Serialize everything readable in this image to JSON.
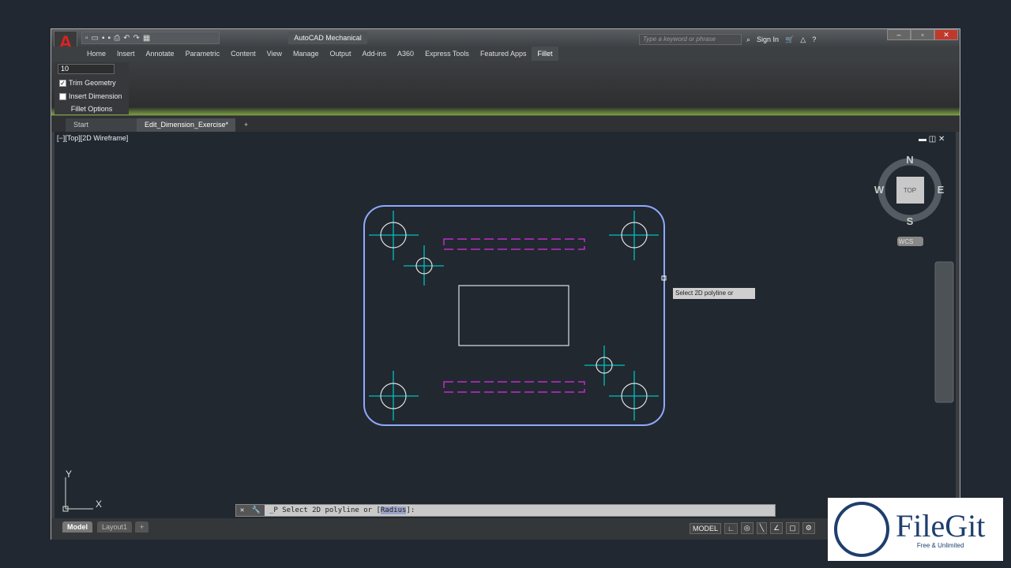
{
  "app": {
    "logo_letter": "A",
    "title": "AutoCAD Mechanical",
    "search_placeholder": "Type a keyword or phrase",
    "sign_in": "Sign In",
    "window_controls": [
      "–",
      "▫",
      "✕"
    ]
  },
  "ribbon": {
    "tabs": [
      "Home",
      "Insert",
      "Annotate",
      "Parametric",
      "Content",
      "View",
      "Manage",
      "Output",
      "Add-ins",
      "A360",
      "Express Tools",
      "Featured Apps",
      "Fillet"
    ],
    "active_tab": "Fillet",
    "fillet": {
      "radius_value": "10",
      "trim_geometry": {
        "label": "Trim Geometry",
        "checked": true
      },
      "insert_dimension": {
        "label": "Insert Dimension",
        "checked": false
      },
      "panel_label": "Fillet Options"
    }
  },
  "doc_tabs": {
    "start": "Start",
    "active": "Edit_Dimension_Exercise*",
    "add": "+"
  },
  "viewport": {
    "label": "[−][Top][2D Wireframe]",
    "viewcube": {
      "n": "N",
      "s": "S",
      "e": "E",
      "w": "W",
      "face": "TOP",
      "ucs": "WCS"
    },
    "ucs_x": "X",
    "ucs_y": "Y"
  },
  "tooltip": "Select 2D polyline or",
  "command_line": {
    "prefix": "_P Select 2D polyline or [",
    "option": "Radius",
    "suffix": "]:"
  },
  "layout_tabs": [
    "Model",
    "Layout1",
    "+"
  ],
  "status": {
    "model": "MODEL"
  },
  "colors": {
    "outline": "#8fa9ff",
    "centerline": "#00c0c0",
    "holes": "#e0e0e0",
    "hidden": "#c02cc8"
  },
  "watermark": {
    "name": "FileGit",
    "tagline": "Free & Unlimited"
  }
}
